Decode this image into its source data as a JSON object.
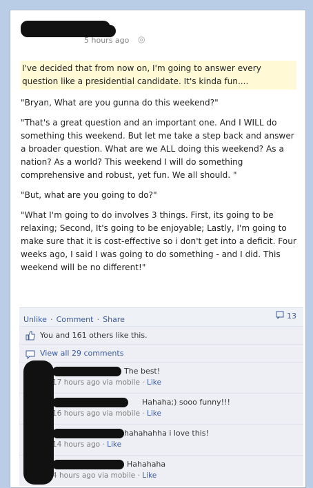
{
  "post": {
    "time_text": "5 hours ago",
    "paragraphs": [
      "I've decided that from now on, I'm going to answer every question like a presidential candidate. It's kinda fun....",
      "\"Bryan, What are you gunna do this weekend?\"",
      "\"That's a great question and an important one. And I WILL do something this weekend. But let me take a step back and answer a broader question. What are we ALL doing this weekend? As a nation? As a world? This weekend I will do something comprehensive and robust, yet fun. We all should. \"",
      "\"But, what are you going to do?\"",
      "\"What I'm going to do involves 3 things. First, its going to be relaxing; Second, It's going to be enjoyable; Lastly, I'm going to make sure that it is cost-effective so i don't get into a deficit. Four weeks ago, I said I was going to do something - and I did. This weekend will be no different!\""
    ],
    "actions": {
      "unlike": "Unlike",
      "comment": "Comment",
      "share": "Share",
      "separator": "·"
    },
    "share_count": "13"
  },
  "likes": {
    "text": "You and 161 others like this."
  },
  "view_all": {
    "text": "View all 29 comments"
  },
  "comments": [
    {
      "text": "The best!",
      "time": "17 hours ago via mobile",
      "like": "Like",
      "sep": "·"
    },
    {
      "text": "Hahaha;) sooo funny!!!",
      "time": "16 hours ago via mobile",
      "like": "Like",
      "sep": "·"
    },
    {
      "text": "hahahahha i love this!",
      "time": "14 hours ago",
      "like": "Like",
      "sep": "·"
    },
    {
      "text": "Hahahaha",
      "time": "4 hours ago via mobile",
      "like": "Like",
      "sep": "·"
    }
  ],
  "colors": {
    "link": "#3b5998",
    "highlight": "#fff9d6",
    "page_bg": "#b9cee6"
  }
}
